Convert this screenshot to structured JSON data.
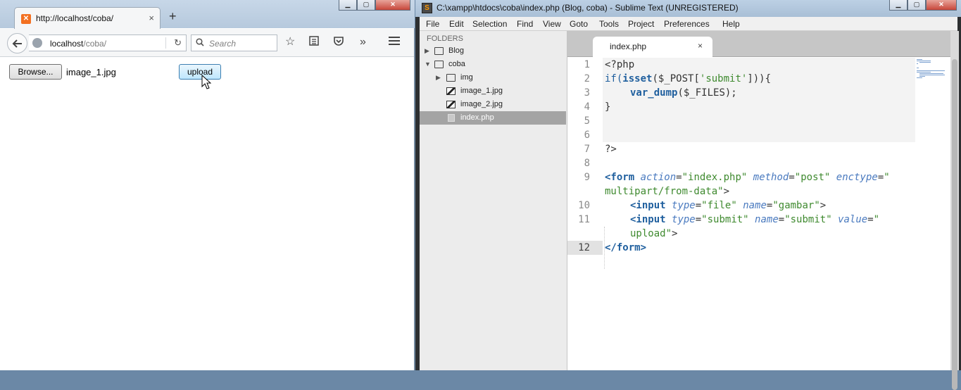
{
  "firefox": {
    "tab_title": "http://localhost/coba/",
    "tab_close": "×",
    "new_tab": "+",
    "url_host": "localhost",
    "url_path": "/coba/",
    "search_placeholder": "Search",
    "page": {
      "browse_label": "Browse...",
      "file_name": "image_1.jpg",
      "upload_label": "upload"
    }
  },
  "sublime": {
    "window_title": "C:\\xampp\\htdocs\\coba\\index.php (Blog, coba) - Sublime Text (UNREGISTERED)",
    "menu": [
      "File",
      "Edit",
      "Selection",
      "Find",
      "View",
      "Goto",
      "Tools",
      "Project",
      "Preferences",
      "Help"
    ],
    "sidebar": {
      "header": "FOLDERS",
      "items": [
        {
          "label": "Blog",
          "type": "folder",
          "expanded": false
        },
        {
          "label": "coba",
          "type": "folder",
          "expanded": true
        },
        {
          "label": "img",
          "type": "folder",
          "expanded": false
        },
        {
          "label": "image_1.jpg",
          "type": "image"
        },
        {
          "label": "image_2.jpg",
          "type": "image"
        },
        {
          "label": "index.php",
          "type": "file",
          "selected": true
        }
      ]
    },
    "tab": {
      "title": "index.php",
      "close": "×"
    },
    "line_numbers": [
      "1",
      "2",
      "3",
      "4",
      "5",
      "6",
      "7",
      "8",
      "9",
      "10",
      "11",
      "12"
    ],
    "current_line": "12",
    "code": {
      "l1": "<?php",
      "l2_if": "if(",
      "l2_isset": "isset",
      "l2_a": "($_POST[",
      "l2_str": "'submit'",
      "l2_b": "])){",
      "l3_fn": "var_dump",
      "l3_rest": "($_FILES);",
      "l4": "}",
      "l7": "?>",
      "form_open": "<form",
      "action_attr": "action",
      "action_val": "\"index.php\"",
      "method_attr": "method",
      "method_val": "\"post\"",
      "enctype_attr": "enctype",
      "enctype_val_a": "\"",
      "enctype_val_b": "multipart/from-data\"",
      "gt": ">",
      "input_open": "<input",
      "type_attr": "type",
      "type_file": "\"file\"",
      "name_attr": "name",
      "name_gambar": "\"gambar\"",
      "type_submit": "\"submit\"",
      "name_submit": "\"submit\"",
      "value_attr": "value",
      "value_a": "\"",
      "value_b": "upload\"",
      "form_close": "</form>",
      "eq": "="
    }
  }
}
